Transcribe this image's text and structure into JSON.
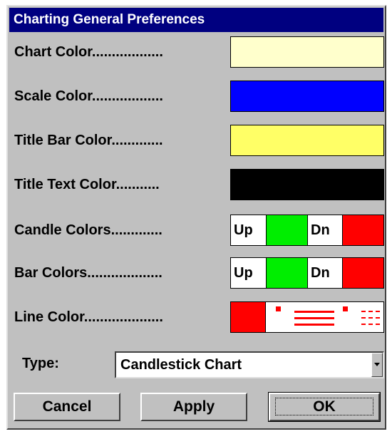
{
  "dialog": {
    "title": "Charting General Preferences"
  },
  "colors": {
    "chart": "#ffffcc",
    "scale": "#0000ff",
    "title_bar": "#ffff66",
    "title_text": "#000000",
    "up": "#00ee00",
    "down": "#ff0000",
    "line": "#ff0000"
  },
  "rows": {
    "chart_color": "Chart Color..................",
    "scale_color": "Scale Color..................",
    "title_bar_color": "Title Bar Color.............",
    "title_text_color": "Title Text Color...........",
    "candle_colors": "Candle Colors.............",
    "bar_colors": "Bar Colors...................",
    "line_color": "Line Color...................."
  },
  "swatch_labels": {
    "up": "Up",
    "down": "Dn"
  },
  "type": {
    "label": "Type:",
    "value": "Candlestick Chart"
  },
  "buttons": {
    "cancel": "Cancel",
    "apply": "Apply",
    "ok": "OK"
  }
}
